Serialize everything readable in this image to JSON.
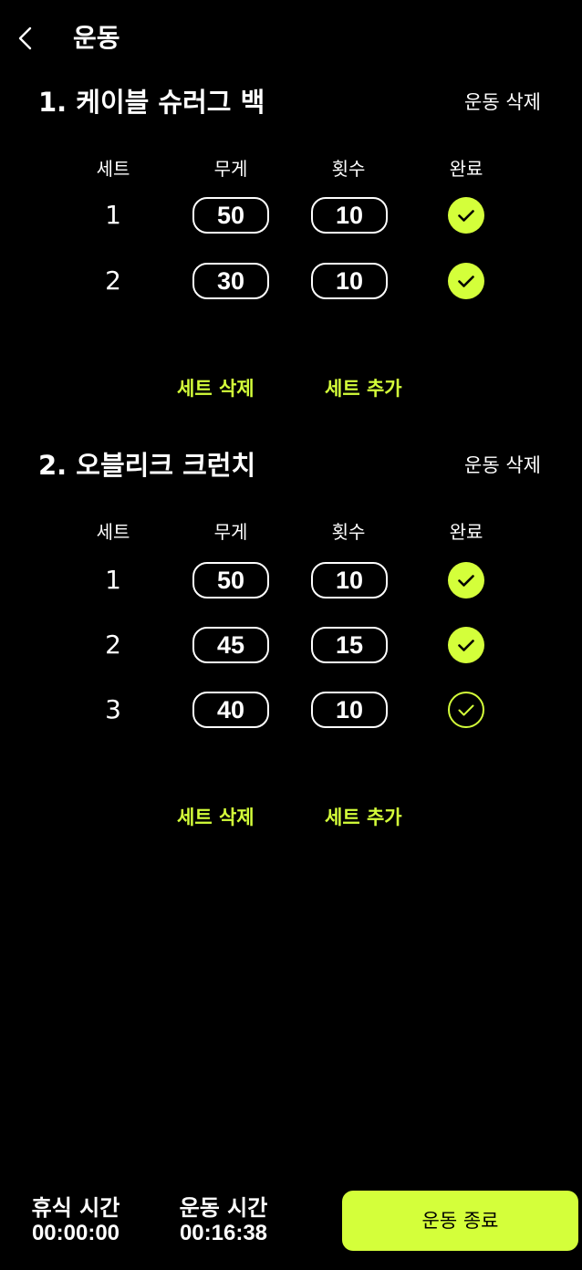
{
  "colors": {
    "accent": "#D4FF3A",
    "background": "#000000",
    "text": "#FFFFFF"
  },
  "header": {
    "back_icon": "chevron-left-icon",
    "title": "운동"
  },
  "columns": {
    "set": "세트",
    "weight": "무게",
    "reps": "횟수",
    "done": "완료"
  },
  "exercises": [
    {
      "title": "1. 케이블 슈러그 백",
      "delete_label": "운동 삭제",
      "sets": [
        {
          "set": "1",
          "weight": "50",
          "reps": "10",
          "done": true
        },
        {
          "set": "2",
          "weight": "30",
          "reps": "10",
          "done": true
        }
      ],
      "delete_set_label": "세트 삭제",
      "add_set_label": "세트 추가"
    },
    {
      "title": "2. 오블리크 크런치",
      "delete_label": "운동 삭제",
      "sets": [
        {
          "set": "1",
          "weight": "50",
          "reps": "10",
          "done": true
        },
        {
          "set": "2",
          "weight": "45",
          "reps": "15",
          "done": true
        },
        {
          "set": "3",
          "weight": "40",
          "reps": "10",
          "done": false
        }
      ],
      "delete_set_label": "세트 삭제",
      "add_set_label": "세트 추가"
    }
  ],
  "footer": {
    "rest_label": "휴식 시간",
    "rest_value": "00:00:00",
    "workout_label": "운동 시간",
    "workout_value": "00:16:38",
    "end_button": "운동 종료"
  }
}
